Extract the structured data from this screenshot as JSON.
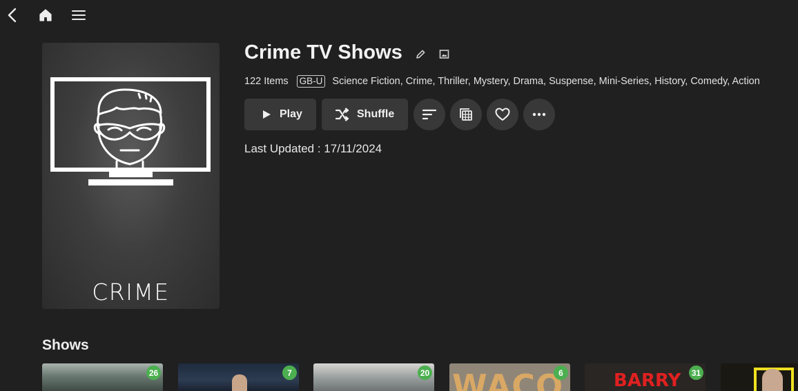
{
  "collection": {
    "title": "Crime TV Shows",
    "items_count": "122 Items",
    "rating": "GB-U",
    "genres": "Science Fiction, Crime, Thriller, Mystery, Drama, Suspense, Mini-Series, History, Comedy, Action",
    "last_updated": "Last Updated : 17/11/2024",
    "poster_text": "CRIME"
  },
  "actions": {
    "play_label": "Play",
    "shuffle_label": "Shuffle"
  },
  "shows": {
    "section_title": "Shows",
    "items": [
      {
        "badge": "26"
      },
      {
        "badge": "7"
      },
      {
        "badge": "20"
      },
      {
        "badge": "6",
        "poster_text": "WACO"
      },
      {
        "badge": "31",
        "poster_text": "BARRY"
      },
      {}
    ]
  },
  "colors": {
    "background": "#202020",
    "button": "#383838",
    "badge": "#4caf50"
  },
  "icons": [
    "back-icon",
    "home-icon",
    "menu-icon",
    "edit-icon",
    "image-icon",
    "play-icon",
    "shuffle-icon",
    "sort-icon",
    "view-icon",
    "heart-icon",
    "more-icon"
  ]
}
